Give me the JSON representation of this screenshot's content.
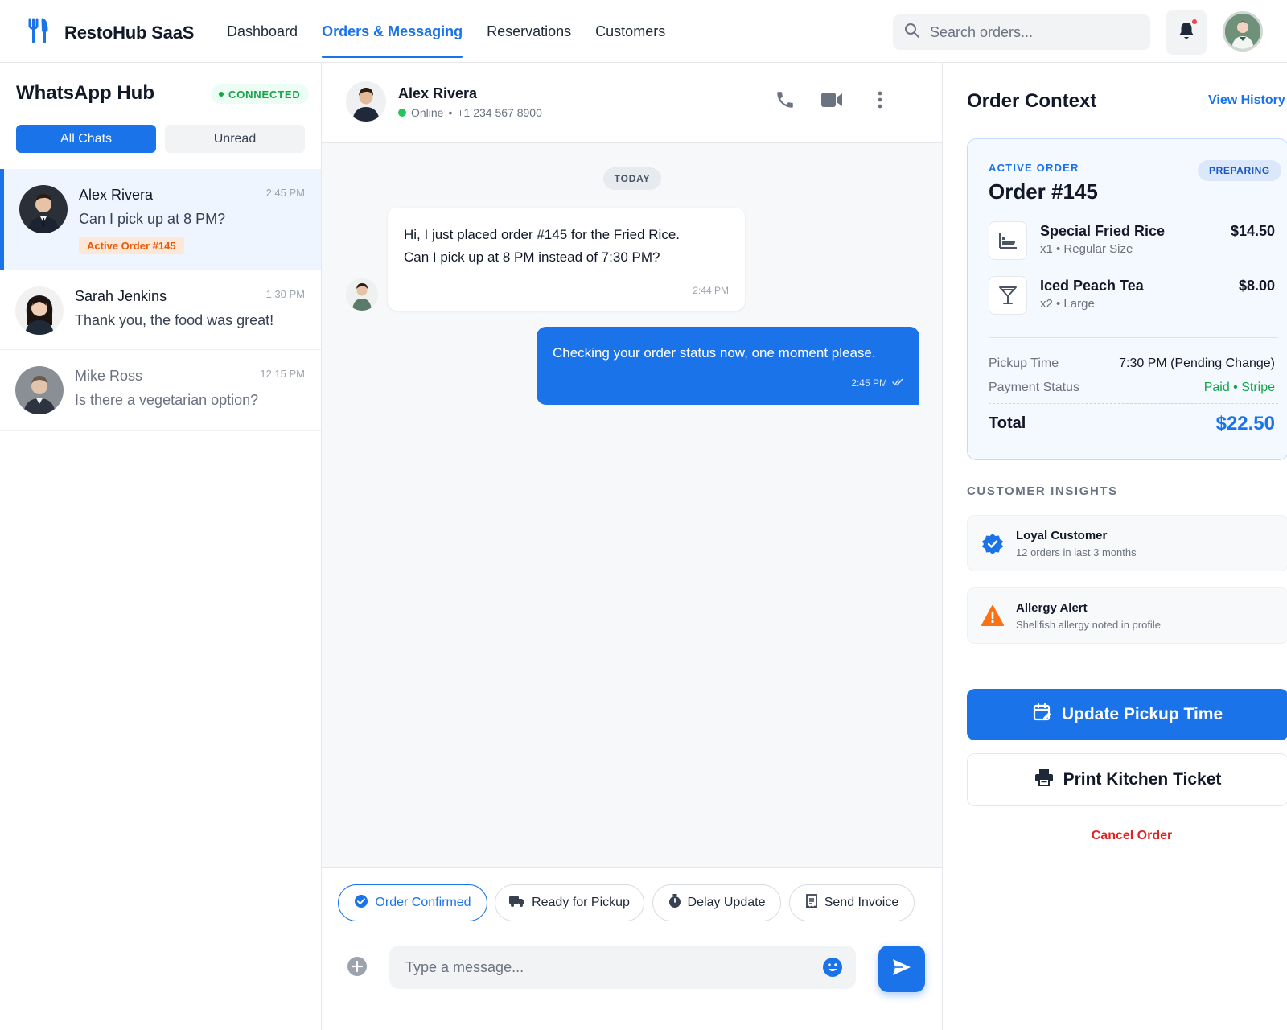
{
  "app": {
    "brand": "RestoHub SaaS",
    "nav": [
      "Dashboard",
      "Orders & Messaging",
      "Reservations",
      "Customers"
    ],
    "active_nav": "Orders & Messaging",
    "search_placeholder": "Search orders..."
  },
  "sidebar": {
    "title": "WhatsApp Hub",
    "status": "CONNECTED",
    "filters": {
      "all": "All Chats",
      "unread": "Unread"
    },
    "chats": [
      {
        "name": "Alex Rivera",
        "time": "2:45 PM",
        "message": "Can I pick up at 8 PM?",
        "tag": "Active Order #145"
      },
      {
        "name": "Sarah Jenkins",
        "time": "1:30 PM",
        "message": "Thank you, the food was great!"
      },
      {
        "name": "Mike Ross",
        "time": "12:15 PM",
        "message": "Is there a vegetarian option?"
      }
    ]
  },
  "conversation": {
    "contact_name": "Alex Rivera",
    "status": "Online",
    "phone": "+1 234 567 8900",
    "day_label": "TODAY",
    "messages": [
      {
        "direction": "in",
        "lines": [
          "Hi, I just placed order #145 for the Fried Rice.",
          "Can I pick up at 8 PM instead of 7:30 PM?"
        ],
        "time": "2:44 PM"
      },
      {
        "direction": "out",
        "text": "Checking your order status now, one moment please.",
        "time": "2:45 PM"
      }
    ],
    "quick_replies": [
      "Order Confirmed",
      "Ready for Pickup",
      "Delay Update",
      "Send Invoice"
    ],
    "input_placeholder": "Type a message..."
  },
  "order": {
    "panel_title": "Order Context",
    "view_history": "View History",
    "label": "ACTIVE ORDER",
    "number": "Order #145",
    "status": "PREPARING",
    "items": [
      {
        "name": "Special Fried Rice",
        "detail": "x1 • Regular Size",
        "price": "$14.50",
        "icon": "rice-bowl-icon"
      },
      {
        "name": "Iced Peach Tea",
        "detail": "x2 • Large",
        "price": "$8.00",
        "icon": "cocktail-glass-icon"
      }
    ],
    "pickup_label": "Pickup Time",
    "pickup_value": "7:30 PM (Pending Change)",
    "payment_label": "Payment Status",
    "payment_value": "Paid • Stripe",
    "total_label": "Total",
    "total_value": "$22.50"
  },
  "insights": {
    "title": "CUSTOMER INSIGHTS",
    "items": [
      {
        "title": "Loyal Customer",
        "sub": "12 orders in last 3 months",
        "icon": "verified-badge-icon"
      },
      {
        "title": "Allergy Alert",
        "sub": "Shellfish allergy noted in profile",
        "icon": "warning-icon"
      }
    ]
  },
  "actions": {
    "primary": "Update Pickup Time",
    "secondary": "Print Kitchen Ticket",
    "cancel": "Cancel Order"
  },
  "colors": {
    "accent": "#1a73e8",
    "success": "#16a34a",
    "warning": "#f97316",
    "danger": "#dc2626"
  }
}
